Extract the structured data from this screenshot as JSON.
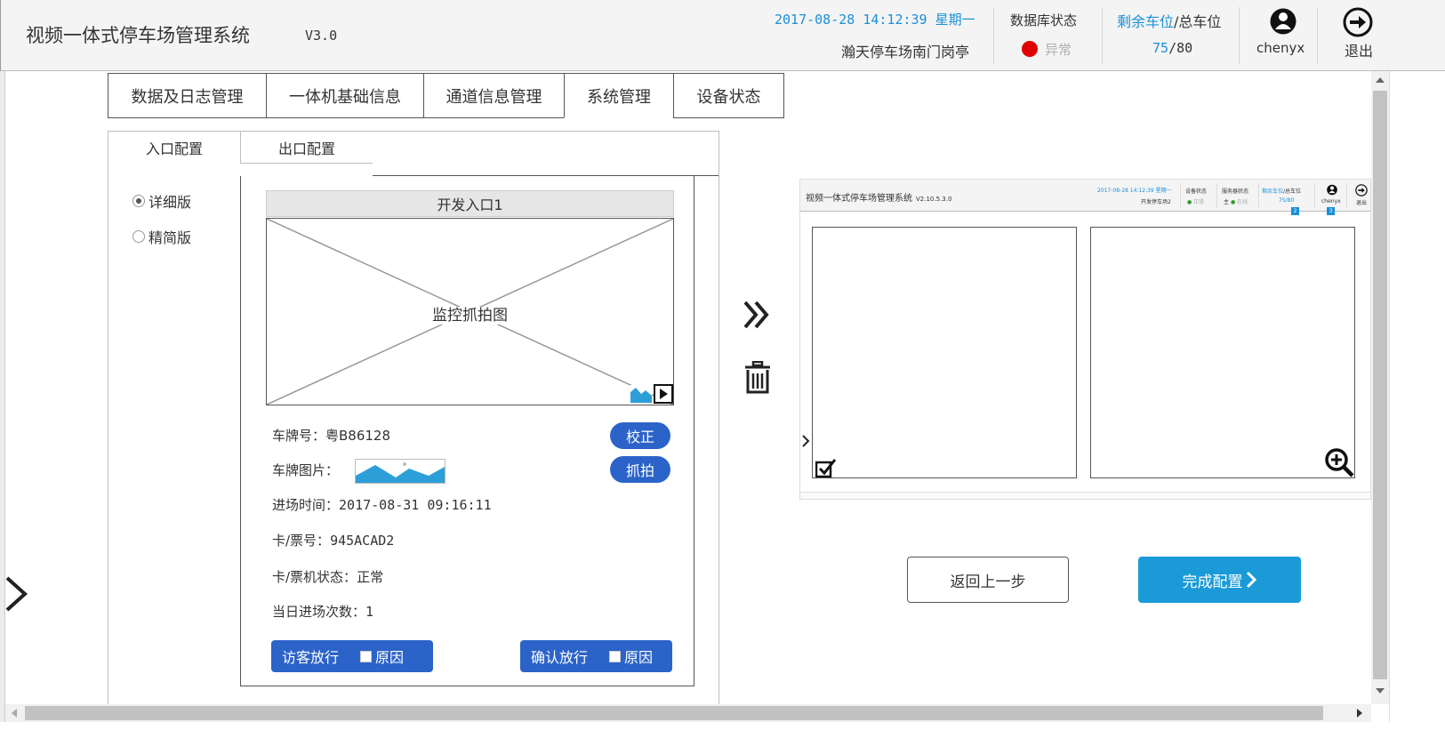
{
  "header": {
    "title": "视频一体式停车场管理系统",
    "version": "V3.0",
    "datetime": "2017-08-28 14:12:39",
    "weekday": "星期一",
    "location": "瀚天停车场南门岗亭",
    "db_status_label": "数据库状态",
    "db_status_value": "异常",
    "db_status_color": "#e10000",
    "spaces_remaining_label": "剩余车位",
    "spaces_total_label": "/总车位",
    "spaces_remaining": "75",
    "spaces_total": "/80",
    "user_name": "chenyx",
    "user_icon": "user-icon",
    "logout_label": "退出",
    "logout_icon": "logout-arrow-icon",
    "accent_color": "#1a8fd8"
  },
  "tabs": [
    {
      "label": "数据及日志管理"
    },
    {
      "label": "一体机基础信息"
    },
    {
      "label": "通道信息管理"
    },
    {
      "label": "系统管理",
      "active": true
    },
    {
      "label": "设备状态"
    }
  ],
  "subtabs": {
    "entrance": "入口配置",
    "exit": "出口配置"
  },
  "mode_options": {
    "detailed": "详细版",
    "simple": "精简版",
    "selected": "详细版"
  },
  "entrance": {
    "camera_title": "开发入口1",
    "camera_placeholder": "监控抓拍图",
    "plate_label": "车牌号：",
    "plate_value": "粤B86128",
    "plate_image_label": "车牌图片：",
    "entry_time_label": "进场时间：",
    "entry_time_value": "2017-08-31 09:16:11",
    "card_label": "卡/票号：",
    "card_value": "945ACAD2",
    "card_status_label": "卡/票机状态：",
    "card_status_value": "正常",
    "daily_count_label": "当日进场次数：",
    "daily_count_value": "1",
    "correct_button": "校正",
    "capture_button": "抓拍",
    "visitor_release_button": "访客放行",
    "confirm_release_button": "确认放行",
    "reason_label": "原因",
    "button_color": "#2b63c9"
  },
  "preview": {
    "title": "视频一体式停车场管理系统",
    "version": "V2.10.5.3.0",
    "datetime": "2017-08-28 14:12:39 星期一",
    "location": "开发停车场2",
    "device_status_label": "设备状态",
    "device_status_value": "正常",
    "server_status_label": "服务器状态",
    "server_status_value": "在线",
    "server_main_label": "主",
    "spaces_label": "剩余车位",
    "spaces_total_label": "/总车位",
    "spaces_value": "75/80",
    "user_name": "chenyx",
    "logout_label": "退出",
    "badge_1": "2",
    "badge_2": "3"
  },
  "buttons": {
    "back": "返回上一步",
    "done": "完成配置",
    "done_color": "#1a9bd7"
  }
}
